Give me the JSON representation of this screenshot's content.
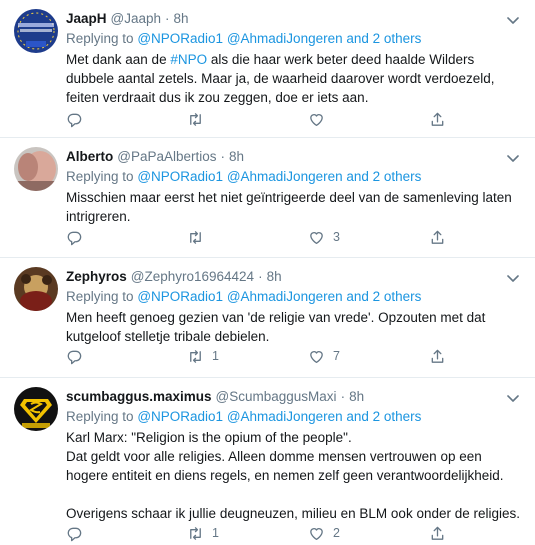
{
  "tweets": [
    {
      "name": "JaapH",
      "handle": "@Jaaph",
      "dot": "·",
      "time": "8h",
      "replying_prefix": "Replying to",
      "mention1": "@NPORadio1",
      "mention2": "@AhmadiJongeren",
      "and_others": "and 2 others",
      "text_before": "Met dank aan de ",
      "hashtag": "#NPO",
      "text_after": " als die haar werk beter deed haalde Wilders dubbele aantal zetels. Maar ja, de waarheid daarover wordt verdoezeld, feiten verdraait dus ik zou zeggen, doe er iets aan.",
      "replies": "",
      "retweets": "",
      "likes": ""
    },
    {
      "name": "Alberto",
      "handle": "@PaPaAlbertios",
      "dot": "·",
      "time": "8h",
      "replying_prefix": "Replying to",
      "mention1": "@NPORadio1",
      "mention2": "@AhmadiJongeren",
      "and_others": "and 2 others",
      "text": "Misschien maar eerst het niet geïntrigeerde deel van de samenleving laten intrigreren.",
      "replies": "",
      "retweets": "",
      "likes": "3"
    },
    {
      "name": "Zephyros",
      "handle": "@Zephyro16964424",
      "dot": "·",
      "time": "8h",
      "replying_prefix": "Replying to",
      "mention1": "@NPORadio1",
      "mention2": "@AhmadiJongeren",
      "and_others": "and 2 others",
      "text": "Men heeft genoeg gezien van 'de religie van vrede'. Opzouten met dat kutgeloof stelletje tribale debielen.",
      "replies": "",
      "retweets": "1",
      "likes": "7"
    },
    {
      "name": "scumbaggus.maximus",
      "handle": "@ScumbaggusMaxi",
      "dot": "·",
      "time": "8h",
      "replying_prefix": "Replying to",
      "mention1": "@NPORadio1",
      "mention2": "@AhmadiJongeren",
      "and_others": "and 2 others",
      "text": "Karl Marx: \"Religion is the opium of the people\".\nDat geldt voor alle religies. Alleen domme mensen vertrouwen op een hogere entiteit en diens regels, en nemen zelf geen verantwoordelijkheid.\n\nOverigens schaar ik jullie deugneuzen, milieu en BLM ook onder de religies.",
      "replies": "",
      "retweets": "1",
      "likes": "2"
    }
  ],
  "icons": {
    "reply": "reply-icon",
    "retweet": "retweet-icon",
    "like": "heart-icon",
    "share": "share-icon",
    "caret": "chevron-down-icon"
  },
  "colors": {
    "link": "#1b95e0",
    "muted": "#657786",
    "text": "#14171a",
    "divider": "#e6ecf0"
  }
}
